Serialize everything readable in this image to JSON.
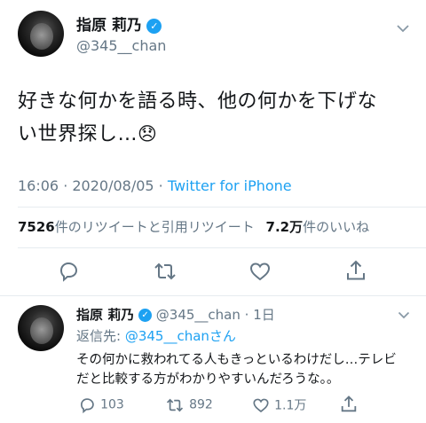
{
  "tweet": {
    "author_name": "指原 莉乃",
    "author_handle": "@345__chan",
    "text_line1": "好きな何かを語る時、他の何かを下げな",
    "text_line2": "い世界探し…",
    "emoji": "😞",
    "time": "16:06 · 2020/08/05 · ",
    "source": "Twitter for iPhone",
    "retweet_count": "7526",
    "retweet_label": "件のリツイートと引用リツイート",
    "like_count": "7.2万",
    "like_label": "件のいいね"
  },
  "reply": {
    "author_name": "指原 莉乃",
    "author_handle": "@345__chan",
    "age": "· 1日",
    "replying_prefix": "返信先: ",
    "replying_to": "@345__chanさん",
    "text_line1": "その何かに救われてる人もきっといるわけだし…テレビ",
    "text_line2": "だと比較する方がわかりやすいんだろうな。。",
    "reply_count": "103",
    "retweet_count": "892",
    "like_count": "1.1万"
  },
  "colors": {
    "accent": "#1da1f2",
    "muted": "#657786"
  },
  "icons": [
    "verified-badge-icon",
    "chevron-down-icon",
    "reply-icon",
    "retweet-icon",
    "like-icon",
    "share-icon"
  ]
}
